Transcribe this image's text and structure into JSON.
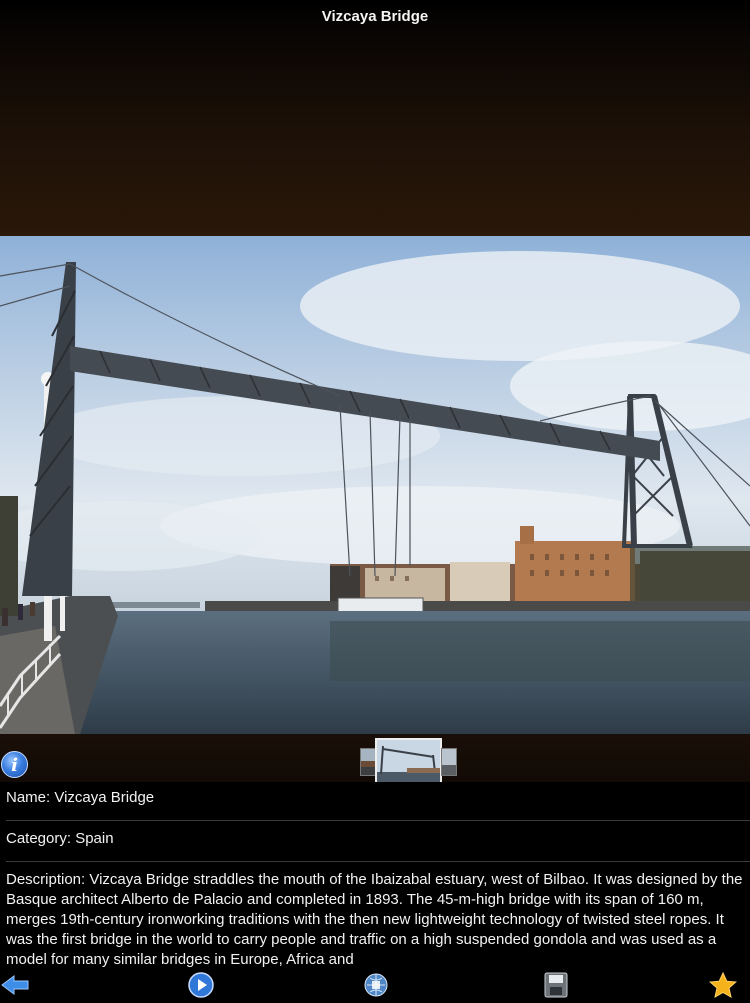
{
  "header": {
    "title": "Vizcaya Bridge"
  },
  "details": {
    "name_line": "Name: Vizcaya Bridge",
    "category_line": "Category: Spain",
    "description_line": "Description: Vizcaya Bridge straddles the mouth of the Ibaizabal estuary, west of Bilbao. It was designed by the Basque architect Alberto de Palacio and completed in 1893. The 45-m-high bridge with its span of 160 m, merges 19th-century ironworking traditions with the then new lightweight technology of twisted steel ropes. It was the first bridge in the world to carry people and traffic on a high suspended gondola and was used as a model for many similar bridges in Europe, Africa and"
  },
  "toolbar": {
    "buttons": [
      {
        "icon": "back-arrow-icon"
      },
      {
        "icon": "play-icon"
      },
      {
        "icon": "globe-icon"
      },
      {
        "icon": "save-disk-icon"
      },
      {
        "icon": "favorite-star-icon"
      }
    ]
  },
  "colors": {
    "accent_blue": "#2f78d8",
    "star_gold": "#f6b21a",
    "header_brown": "#2a1809"
  }
}
